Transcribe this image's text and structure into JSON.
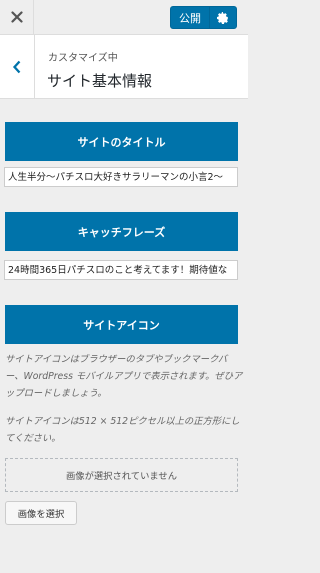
{
  "topbar": {
    "close_icon": "close-icon",
    "publish_label": "公開",
    "settings_icon": "gear-icon"
  },
  "header": {
    "back_icon": "chevron-left-icon",
    "breadcrumb": "カスタマイズ中",
    "title": "サイト基本情報"
  },
  "site_title": {
    "heading": "サイトのタイトル",
    "value": "人生半分〜パチスロ大好きサラリーマンの小言2〜"
  },
  "tagline": {
    "heading": "キャッチフレーズ",
    "value": "24時間365日パチスロのこと考えてます！期待値な"
  },
  "site_icon": {
    "heading": "サイトアイコン",
    "description1": "サイトアイコンはブラウザーのタブやブックマークバー、WordPress モバイルアプリで表示されます。ぜひアップロードしましょう。",
    "description2": "サイトアイコンは512 × 512ピクセル以上の正方形にしてください。",
    "no_image_text": "画像が選択されていません",
    "select_button": "画像を選択"
  },
  "colors": {
    "accent": "#0073aa",
    "background": "#eeeeee"
  }
}
